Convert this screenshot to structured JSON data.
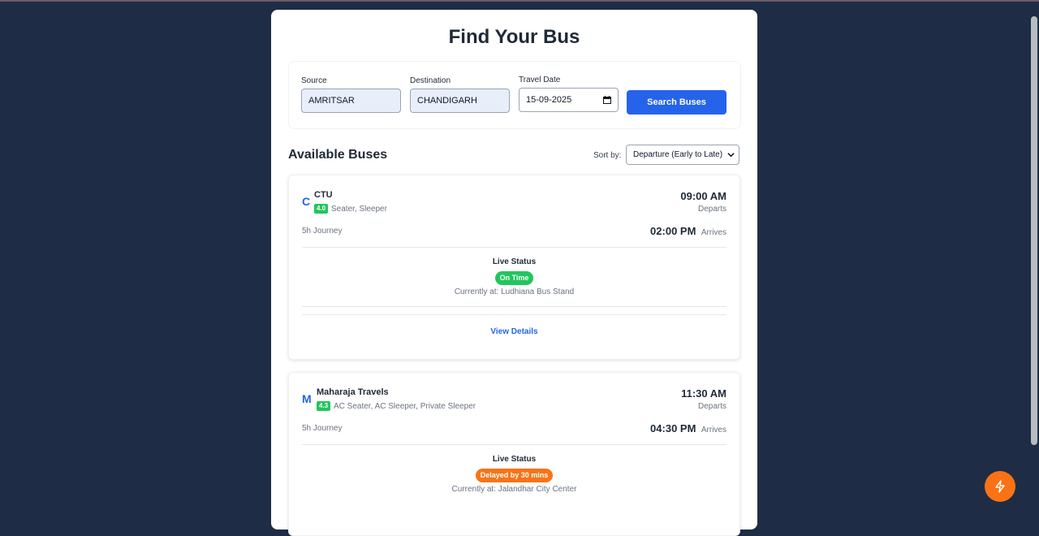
{
  "page": {
    "title": "Find Your Bus"
  },
  "search": {
    "source_label": "Source",
    "source_value": "AMRITSAR",
    "destination_label": "Destination",
    "destination_value": "CHANDIGARH",
    "date_label": "Travel Date",
    "date_value": "15-09-2025",
    "button_label": "Search Buses"
  },
  "results": {
    "heading": "Available Buses",
    "sort_label": "Sort by:",
    "sort_value": "Departure (Early to Late)"
  },
  "buses": [
    {
      "initial": "C",
      "name": "CTU",
      "rating": "4.0",
      "types": "Seater, Sleeper",
      "depart_time": "09:00 AM",
      "depart_label": "Departs",
      "journey": "5h Journey",
      "arrive_time": "02:00 PM",
      "arrive_label": "Arrives",
      "live_label": "Live Status",
      "status": "On Time",
      "status_color": "#22c55e",
      "location": "Currently at: Ludhiana Bus Stand",
      "details_label": "View Details"
    },
    {
      "initial": "M",
      "name": "Maharaja Travels",
      "rating": "4.3",
      "types": "AC Seater, AC Sleeper, Private Sleeper",
      "depart_time": "11:30 AM",
      "depart_label": "Departs",
      "journey": "5h Journey",
      "arrive_time": "04:30 PM",
      "arrive_label": "Arrives",
      "live_label": "Live Status",
      "status": "Delayed by 30 mins",
      "status_color": "#f97316",
      "location": "Currently at: Jalandhar City Center"
    }
  ],
  "colors": {
    "background": "#1e2d45",
    "accent": "#2563eb",
    "fab": "#f97316"
  },
  "icons": {
    "fab": "lightning-icon",
    "date": "calendar-icon",
    "sort": "chevron-down-icon"
  }
}
